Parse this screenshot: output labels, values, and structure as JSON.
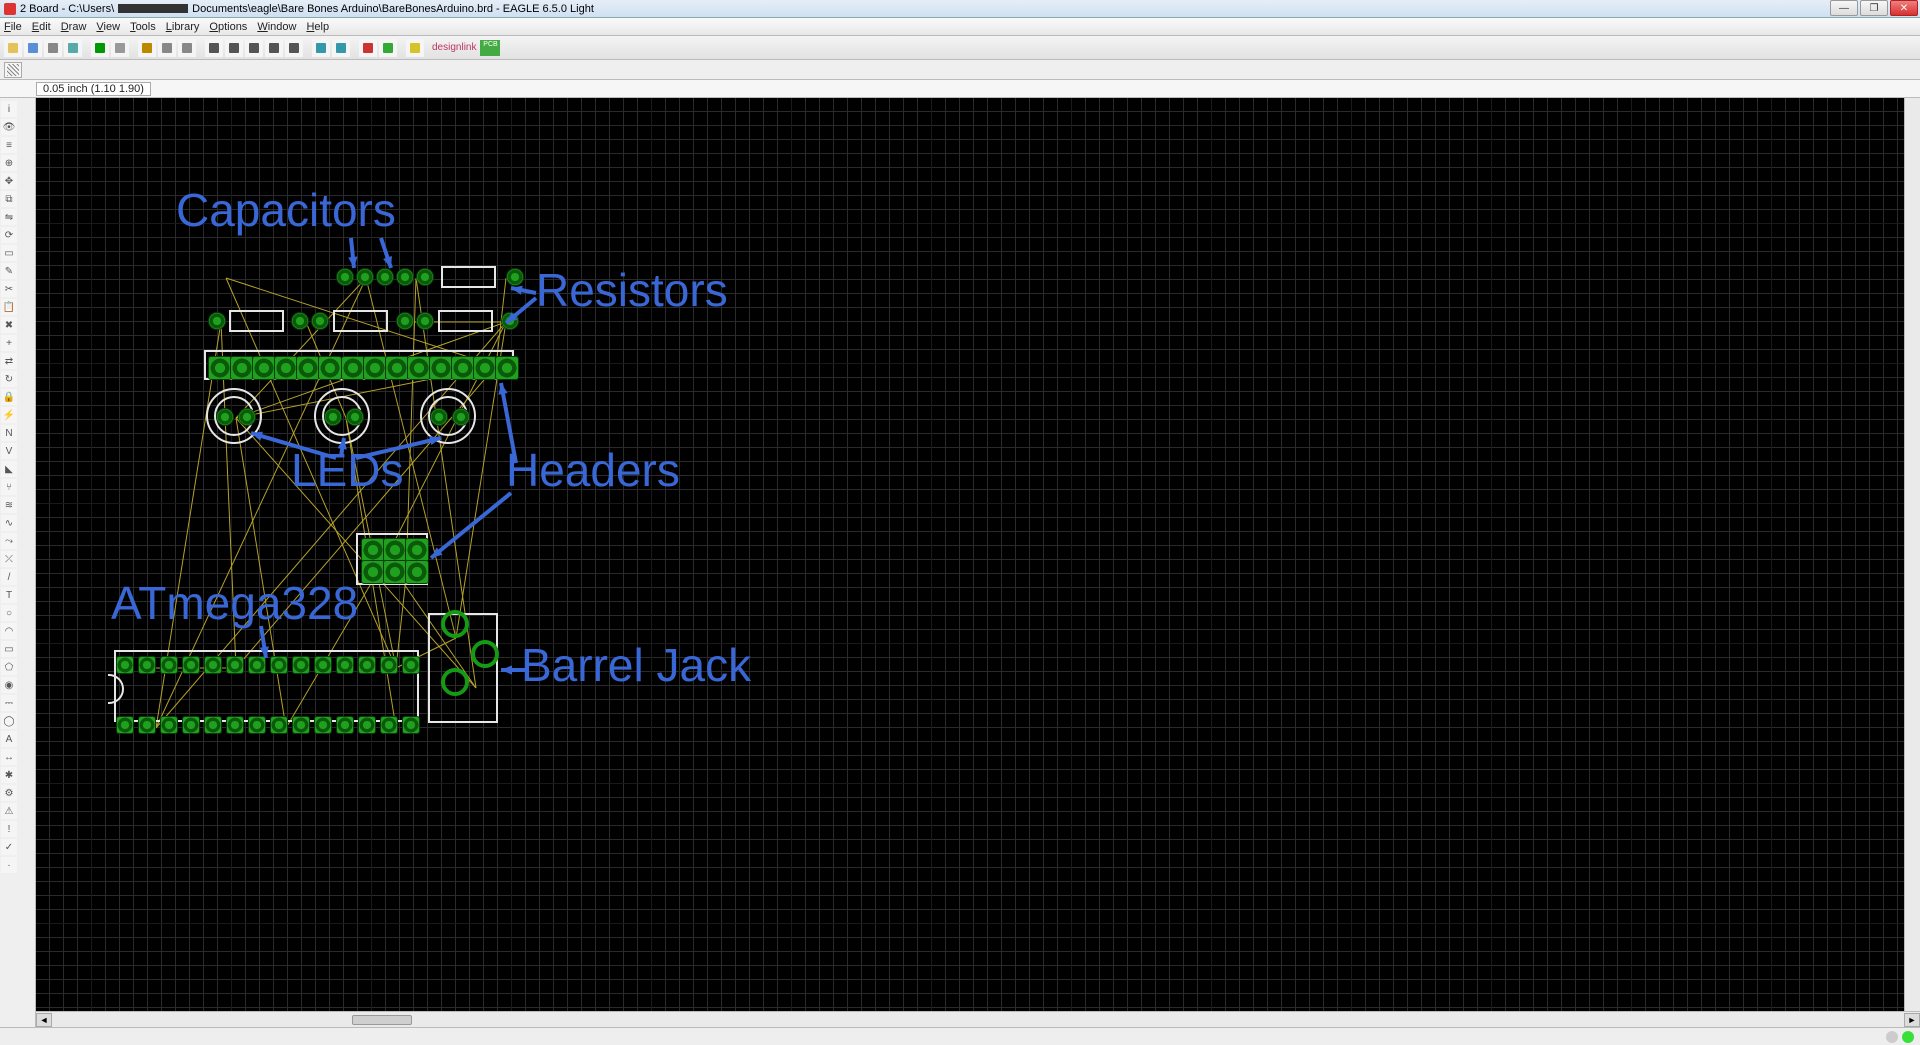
{
  "window": {
    "title_prefix": "2 Board - C:\\Users\\",
    "title_path": "Documents\\eagle\\Bare Bones Arduino\\BareBonesArduino.brd - EAGLE 6.5.0 Light",
    "minimize": "—",
    "maximize": "❐",
    "close": "✕"
  },
  "menu": {
    "file": "File",
    "edit": "Edit",
    "draw": "Draw",
    "view": "View",
    "tools": "Tools",
    "library": "Library",
    "options": "Options",
    "window": "Window",
    "help": "Help"
  },
  "toolbar": {
    "designlink": "designlink",
    "pcbquote": "PCB quote"
  },
  "info": {
    "coord": "0.05 inch (1.10 1.90)"
  },
  "annotations": {
    "capacitors": "Capacitors",
    "resistors": "Resistors",
    "leds": "LEDs",
    "headers": "Headers",
    "atmega": "ATmega328",
    "barrel": "Barrel Jack"
  },
  "palette_icons": [
    "info-icon",
    "eye-icon",
    "layer-icon",
    "mark-icon",
    "move-icon",
    "copy-icon",
    "mirror-icon",
    "rotate-icon",
    "group-icon",
    "change-icon",
    "cut-icon",
    "paste-icon",
    "delete-icon",
    "add-icon",
    "pinswap-icon",
    "replace-icon",
    "lock-icon",
    "smash-icon",
    "name-icon",
    "value-icon",
    "miter-icon",
    "split-icon",
    "optimize-icon",
    "meander-icon",
    "route-icon",
    "ripup-icon",
    "wire-icon",
    "text-icon",
    "circle-icon",
    "arc-icon",
    "rect-icon",
    "polygon-icon",
    "via-icon",
    "signal-icon",
    "hole-icon",
    "attribute-icon",
    "dimension-icon",
    "ratsnest-icon",
    "auto-icon",
    "erc-icon",
    "errors-icon",
    "drc-icon",
    "mark2-icon"
  ],
  "toolbar_icons": [
    "open-icon",
    "save-icon",
    "print-icon",
    "cam-icon",
    "sep",
    "board-icon",
    "sheet-icon",
    "sep",
    "use-icon",
    "script-icon",
    "ulp-icon",
    "sep",
    "zoom-fit-icon",
    "zoom-in-icon",
    "zoom-out-icon",
    "zoom-redraw-icon",
    "zoom-select-icon",
    "sep",
    "undo-icon",
    "redo-icon",
    "sep",
    "cancel-icon",
    "go-icon",
    "sep",
    "help-icon"
  ]
}
